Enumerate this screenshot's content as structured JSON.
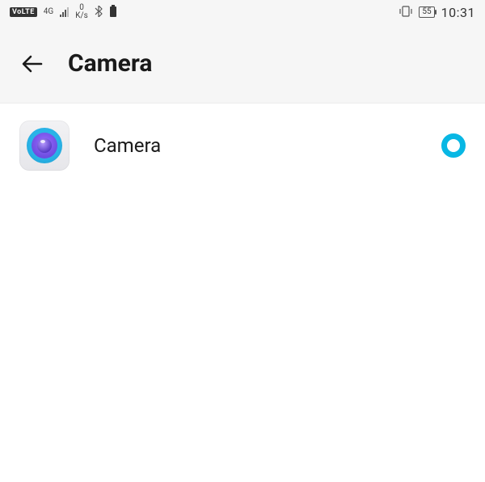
{
  "status": {
    "volte": "VoLTE",
    "network": "4G",
    "speed_value": "0",
    "speed_unit": "K/s",
    "battery": "55",
    "time": "10:31"
  },
  "header": {
    "title": "Camera"
  },
  "list": {
    "items": [
      {
        "label": "Camera",
        "selected": true
      }
    ]
  },
  "colors": {
    "accent": "#08b7e4"
  }
}
